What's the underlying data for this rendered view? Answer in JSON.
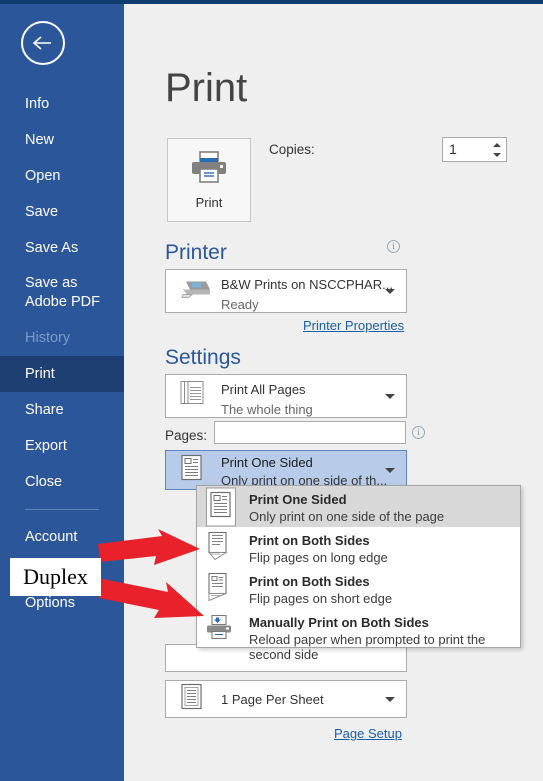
{
  "window": {
    "accent_color": "#2B579A",
    "top_strip_color": "#0F3D6E"
  },
  "sidebar": {
    "back_icon": "back-arrow-icon",
    "items": [
      {
        "label": "Info",
        "state": "normal"
      },
      {
        "label": "New",
        "state": "normal"
      },
      {
        "label": "Open",
        "state": "normal"
      },
      {
        "label": "Save",
        "state": "normal"
      },
      {
        "label": "Save As",
        "state": "normal"
      },
      {
        "label": "Save as Adobe PDF",
        "state": "normal"
      },
      {
        "label": "History",
        "state": "disabled"
      },
      {
        "label": "Print",
        "state": "active"
      },
      {
        "label": "Share",
        "state": "normal"
      },
      {
        "label": "Export",
        "state": "normal"
      },
      {
        "label": "Close",
        "state": "normal"
      },
      {
        "label": "Account",
        "state": "normal"
      },
      {
        "label": "Options",
        "state": "normal"
      }
    ]
  },
  "main": {
    "page_title": "Print",
    "print_button": {
      "label": "Print",
      "icon": "printer-icon"
    },
    "copies": {
      "label": "Copies:",
      "value": "1"
    },
    "printer_section": {
      "heading": "Printer",
      "info_icon": "info-icon",
      "selected": {
        "name": "B&W Prints on NSCCPHAR...",
        "status": "Ready",
        "icon": "printer-device-icon"
      },
      "properties_link": "Printer Properties"
    },
    "settings_section": {
      "heading": "Settings",
      "print_range": {
        "title": "Print All Pages",
        "subtitle": "The whole thing",
        "icon": "pages-stack-icon"
      },
      "pages_label": "Pages:",
      "pages_value": "",
      "pages_info_icon": "info-icon",
      "duplex": {
        "title": "Print One Sided",
        "subtitle": "Only print on one side of th...",
        "icon": "one-sided-page-icon"
      },
      "pages_per_sheet": {
        "title": "1 Page Per Sheet",
        "icon": "single-page-icon"
      },
      "page_setup_link": "Page Setup"
    },
    "duplex_dropdown": {
      "open": true,
      "options": [
        {
          "title": "Print One Sided",
          "subtitle": "Only print on one side of the page",
          "icon": "one-sided-page-icon",
          "selected": true
        },
        {
          "title": "Print on Both Sides",
          "subtitle": "Flip pages on long edge",
          "icon": "both-sides-long-icon",
          "selected": false
        },
        {
          "title": "Print on Both Sides",
          "subtitle": "Flip pages on short edge",
          "icon": "both-sides-short-icon",
          "selected": false
        },
        {
          "title": "Manually Print on Both Sides",
          "subtitle": "Reload paper when prompted to print the second side",
          "icon": "manual-duplex-icon",
          "selected": false
        }
      ]
    }
  },
  "annotations": {
    "callout_label": "Duplex",
    "arrow_color": "#E8212A",
    "arrows": [
      {
        "name": "arrow-upper",
        "points_to": "print-on-both-sides-long-edge"
      },
      {
        "name": "arrow-lower",
        "points_to": "print-on-both-sides-short-edge"
      }
    ]
  }
}
